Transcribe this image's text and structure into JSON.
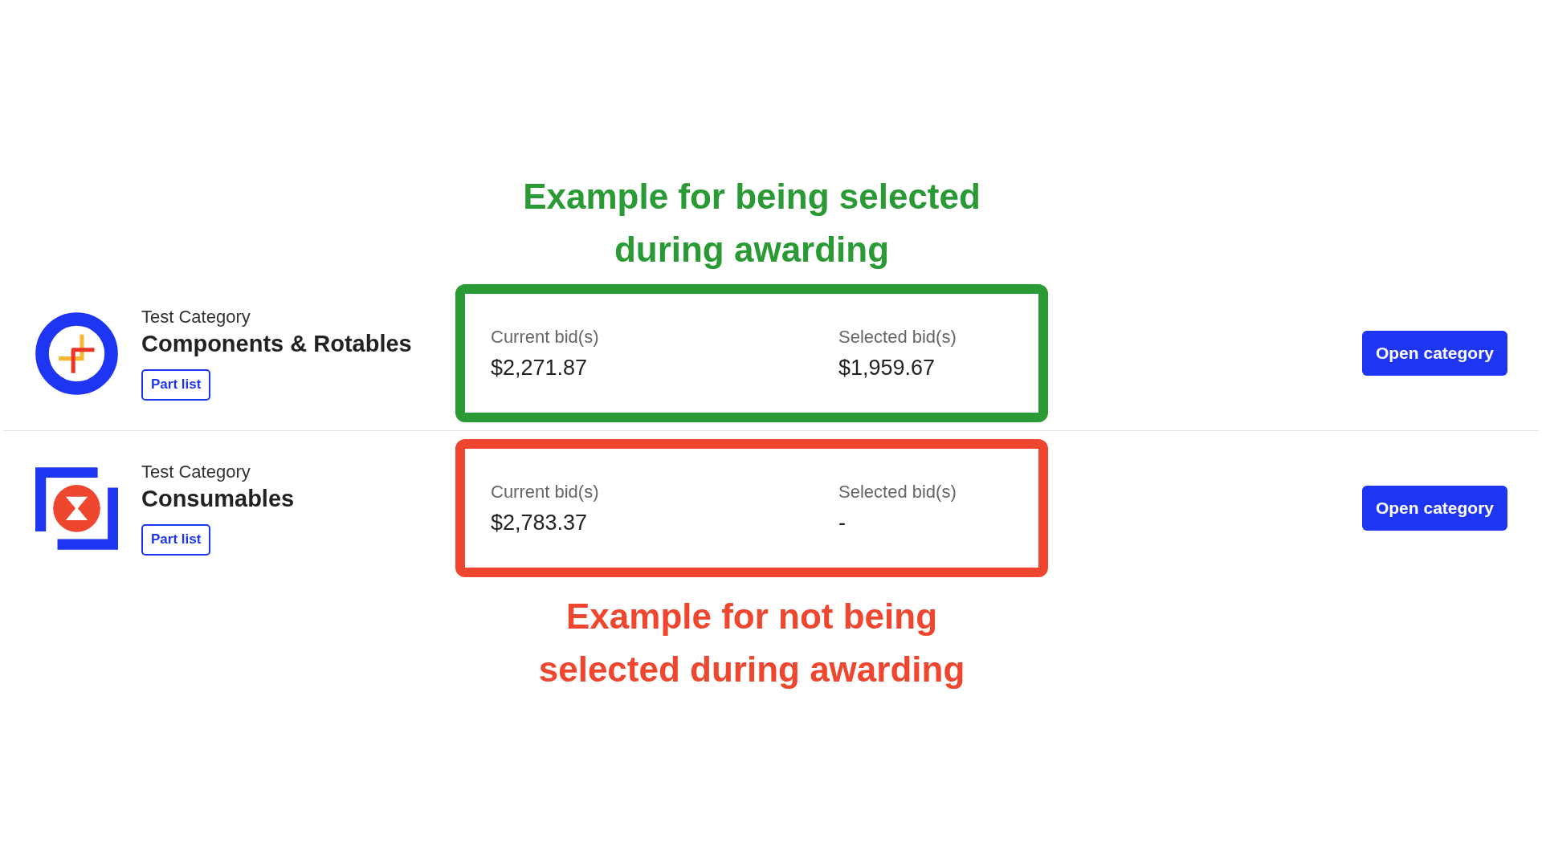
{
  "categories": [
    {
      "label": "Test Category",
      "title": "Components & Rotables",
      "part_list_button": "Part list",
      "current_bid": {
        "label": "Current bid(s)",
        "value": "$2,271.87"
      },
      "selected_bid": {
        "label": "Selected bid(s)",
        "value": "$1,959.67"
      },
      "open_button": "Open category",
      "annotation": {
        "color": "#2a9a35",
        "caption_above": "Example for being selected during awarding"
      }
    },
    {
      "label": "Test Category",
      "title": "Consumables",
      "part_list_button": "Part list",
      "current_bid": {
        "label": "Current bid(s)",
        "value": "$2,783.37"
      },
      "selected_bid": {
        "label": "Selected bid(s)",
        "value": "-"
      },
      "open_button": "Open category",
      "annotation": {
        "color": "#ef4630",
        "caption_below": "Example for not being selected during awarding"
      }
    }
  ]
}
